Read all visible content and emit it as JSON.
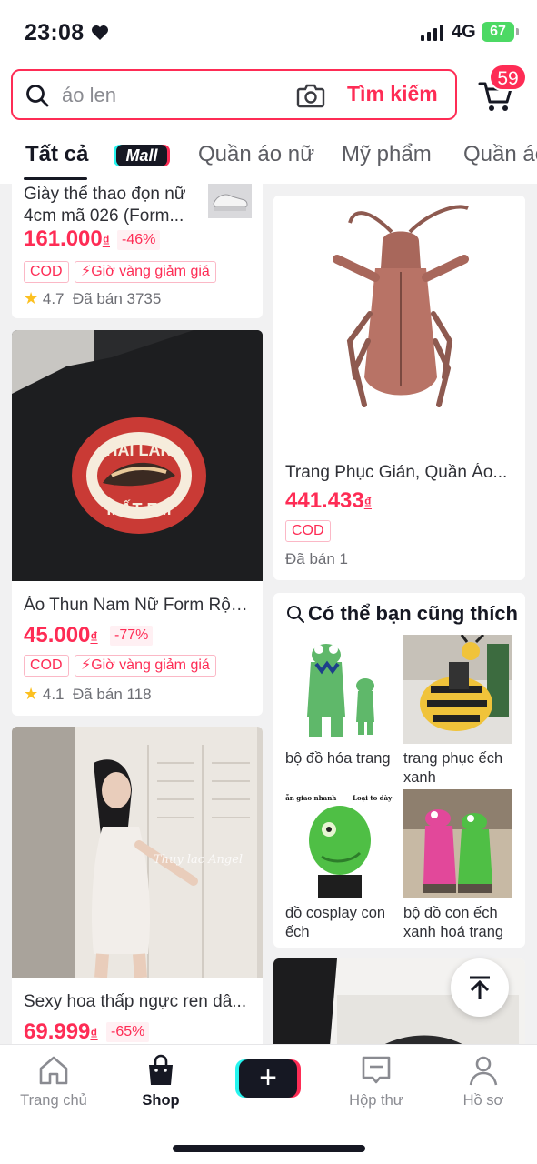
{
  "status_bar": {
    "time": "23:08",
    "network": "4G",
    "battery": "67"
  },
  "search": {
    "placeholder": "áo len",
    "button_label": "Tìm kiếm"
  },
  "cart": {
    "badge_count": "59"
  },
  "tabs": [
    {
      "label": "Tất cả",
      "active": true
    },
    {
      "label": "Mall",
      "badge": true
    },
    {
      "label": "Quần áo nữ"
    },
    {
      "label": "Mỹ phẩm"
    },
    {
      "label": "Quần áo"
    }
  ],
  "products": [
    {
      "title": "Giày thể thao đọn nữ 4cm mã 026 (Form...",
      "price": "161.000",
      "currency": "₫",
      "discount": "-46%",
      "tags": [
        "COD",
        "Giờ vàng giảm giá"
      ],
      "rating": "4.7",
      "sold": "Đã bán 3735"
    },
    {
      "title": "Áo Thun Nam Nữ Form Rộn...",
      "price": "45.000",
      "currency": "₫",
      "discount": "-77%",
      "tags": [
        "COD",
        "Giờ vàng giảm giá"
      ],
      "rating": "4.1",
      "sold": "Đã bán 118",
      "image_text": [
        "HAI LẦN",
        "MẤT EM"
      ]
    },
    {
      "title": "Sexy hoa thấp ngực ren dâ...",
      "price": "69.999",
      "currency": "₫",
      "discount": "-65%",
      "image_watermark": "Thuy lac Angel"
    },
    {
      "title": "Trang Phục Gián, Quần Áo...",
      "price": "441.433",
      "currency": "₫",
      "tags": [
        "COD"
      ],
      "sold": "Đã bán 1"
    }
  ],
  "suggestions": {
    "title": "Có thể bạn cũng thích",
    "items": [
      {
        "label": "bộ đồ hóa trang"
      },
      {
        "label": "trang phục ếch xanh"
      },
      {
        "label": "đồ cosplay con ếch",
        "image_text": [
          "Có sẵn giao nhanh",
          "Loại to dày đẹp"
        ]
      },
      {
        "label": "bộ đồ con ếch xanh hoá trang"
      }
    ]
  },
  "bottom_nav": [
    {
      "label": "Trang chủ"
    },
    {
      "label": "Shop",
      "active": true
    },
    {
      "label": "+"
    },
    {
      "label": "Hộp thư"
    },
    {
      "label": "Hồ sơ"
    }
  ],
  "colors": {
    "accent": "#fe2c55",
    "cyan": "#25f4ee",
    "text": "#161823",
    "star": "#fcc020"
  }
}
